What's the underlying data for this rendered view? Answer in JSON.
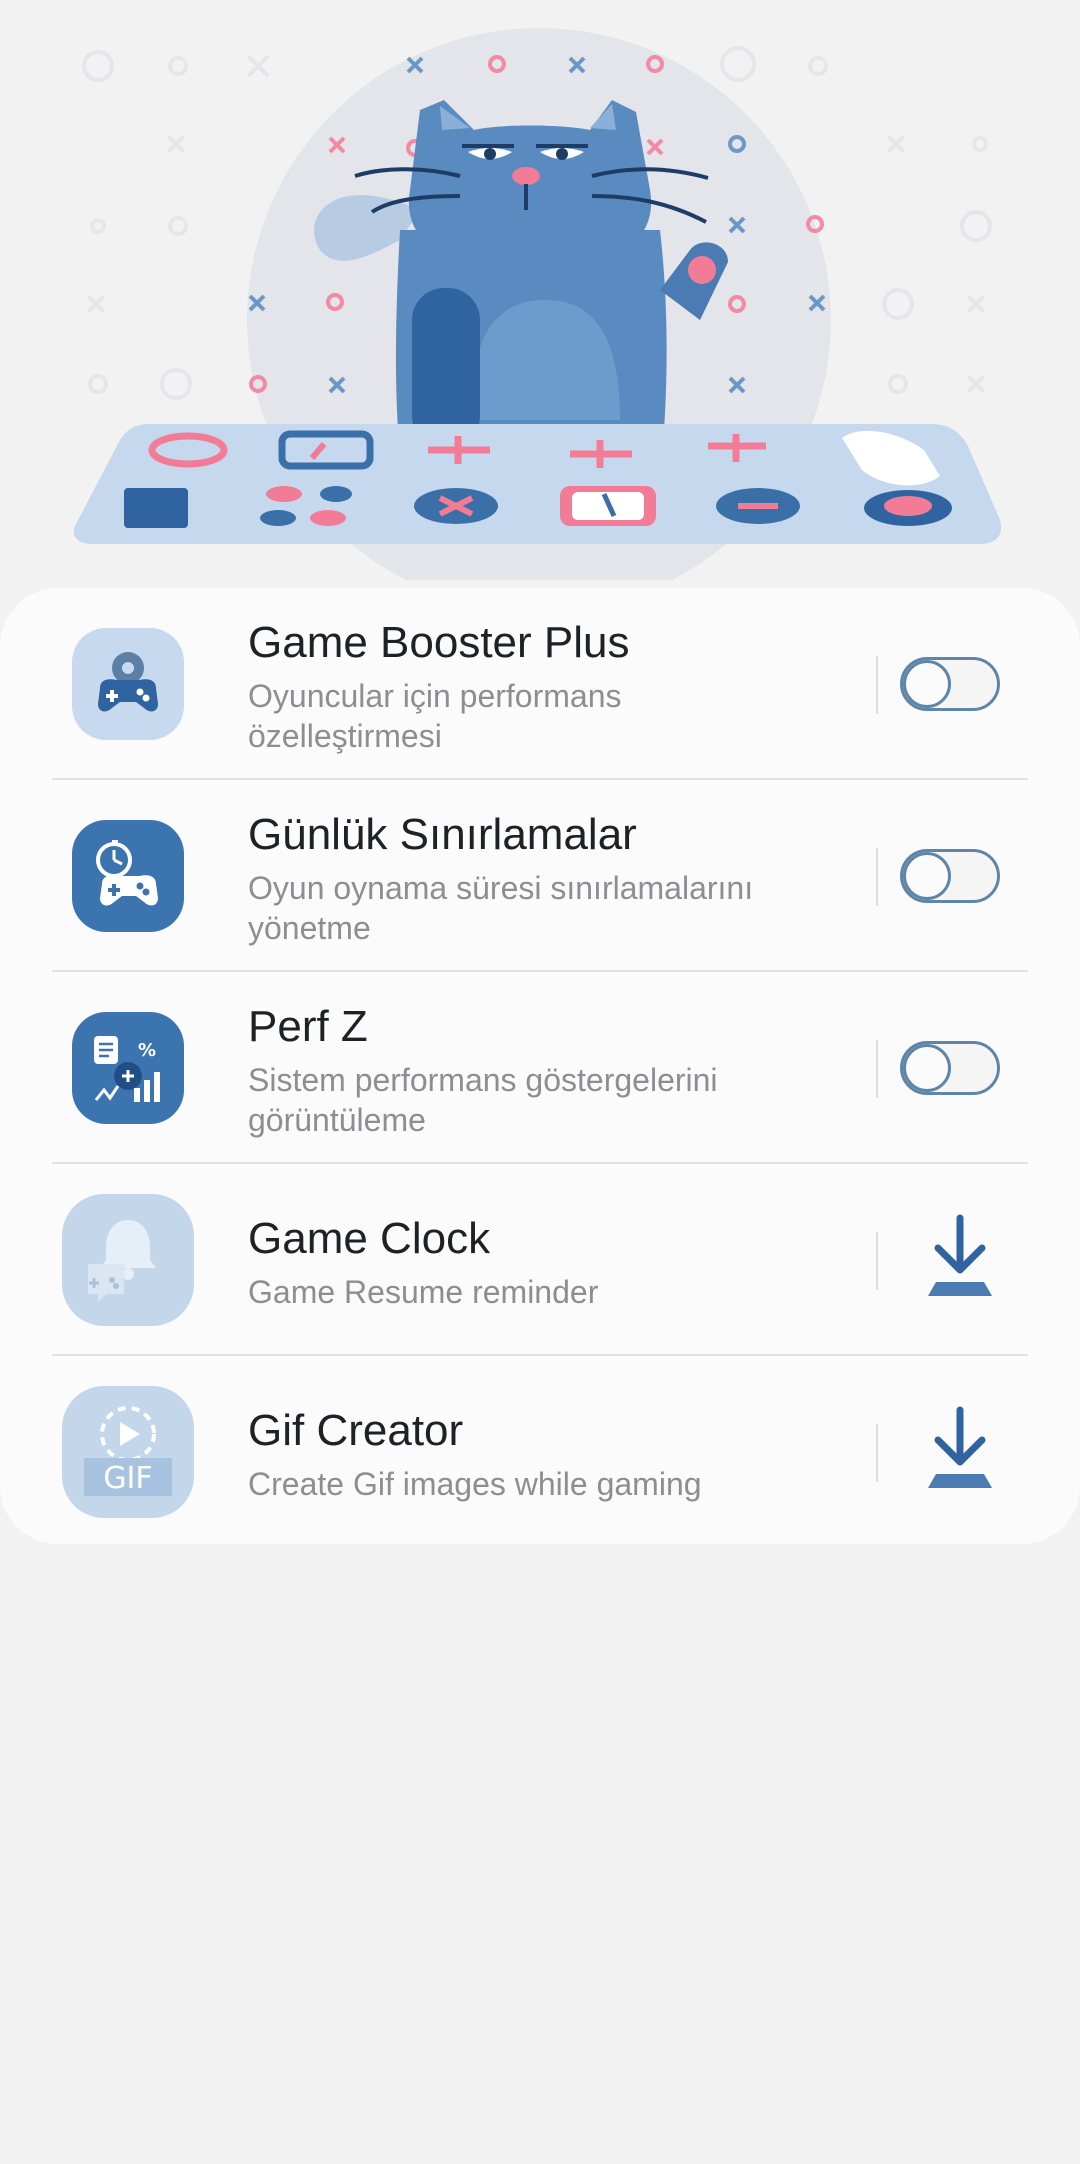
{
  "colors": {
    "background": "#f2f2f3",
    "panel": "#fbfbfb",
    "accent": "#3a6fa8",
    "toggle_border": "#5e86a8",
    "title_text": "#202124",
    "subtitle_text": "#8e8e90",
    "hero_pink": "#f0708c",
    "hero_blue": "#4d82b8"
  },
  "hero": {
    "illustration": "cat-at-gaming-table"
  },
  "features": [
    {
      "title": "Game Booster Plus",
      "subtitle": "Oyuncular için performans özelleştirmesi",
      "icon": "gamepad-gear-icon",
      "control": "toggle",
      "enabled": false
    },
    {
      "title": "Günlük Sınırlamalar",
      "subtitle": "Oyun oynama süresi sınırlamalarını yönetme",
      "icon": "gamepad-timer-icon",
      "control": "toggle",
      "enabled": false
    },
    {
      "title": "Perf Z",
      "subtitle": "Sistem performans göstergelerini görüntüleme",
      "icon": "performance-stats-icon",
      "control": "toggle",
      "enabled": false
    },
    {
      "title": "Game Clock",
      "subtitle": "Game Resume reminder",
      "icon": "game-clock-bell-icon",
      "control": "download"
    },
    {
      "title": "Gif Creator",
      "subtitle": "Create Gif images while gaming",
      "icon": "gif-creator-icon",
      "icon_text": "GIF",
      "control": "download"
    }
  ]
}
